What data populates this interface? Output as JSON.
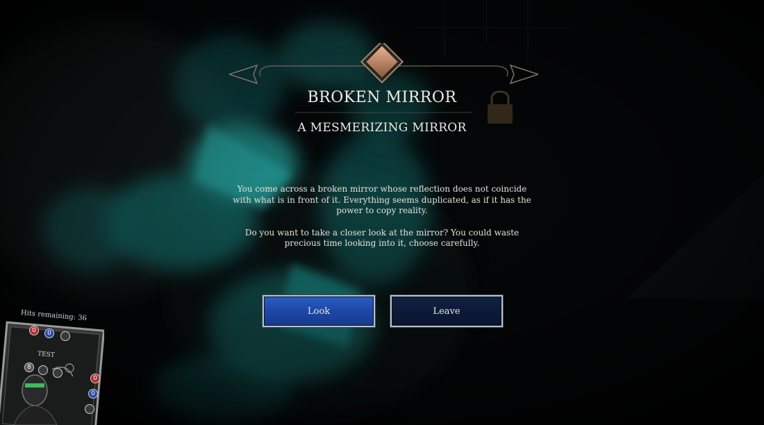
{
  "event": {
    "title": "BROKEN MIRROR",
    "subtitle": "A MESMERIZING MIRROR",
    "paragraphs": [
      "You come across a broken mirror whose reflection does not coincide with what is in front of it. Everything seems duplicated, as if it has the power to copy reality.",
      "Do you want to take a closer look at the mirror? You could waste precious time looking into it, choose carefully."
    ]
  },
  "choices": {
    "look_label": "Look",
    "leave_label": "Leave"
  },
  "player": {
    "hits_remaining": "Hits remaining: 36",
    "card_name": "TEST",
    "stats_top": [
      "0",
      "0"
    ],
    "level": "8",
    "stats_side": [
      "0",
      "0"
    ]
  },
  "colors": {
    "accent_cyan": "#2fd6d0",
    "look_button": "#1d47a8",
    "leave_button": "#0c1a38",
    "gem": "#c98a62"
  },
  "icons": [
    "diamond-gem-icon",
    "padlock-icon",
    "arrow-left-icon",
    "arrow-right-icon"
  ]
}
